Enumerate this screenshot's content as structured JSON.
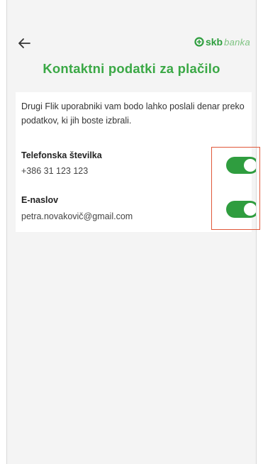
{
  "app": {
    "brand_main": "skb",
    "brand_sub": "banka"
  },
  "header": {
    "back_icon": "arrow-left-icon",
    "title": "Kontaktni podatki za plačilo"
  },
  "card": {
    "description": "Drugi Flik uporabniki vam bodo lahko poslali denar preko podatkov, ki jih boste izbrali.",
    "items": [
      {
        "label": "Telefonska številka",
        "value": "+386 31 123 123",
        "enabled": true
      },
      {
        "label": "E-naslov",
        "value": "petra.novakovič@gmail.com",
        "enabled": true
      }
    ]
  },
  "colors": {
    "accent": "#3aa845",
    "toggle_on": "#2f9d3f",
    "highlight": "#e0583a",
    "background": "#f4f4f4"
  }
}
